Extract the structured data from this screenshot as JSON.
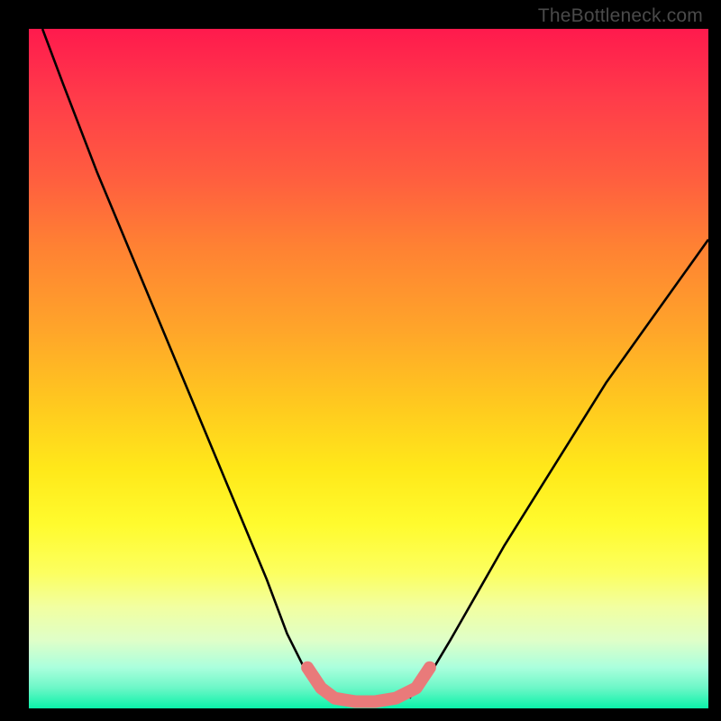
{
  "watermark": "TheBottleneck.com",
  "chart_data": {
    "type": "line",
    "title": "",
    "xlabel": "",
    "ylabel": "",
    "xlim": [
      0,
      100
    ],
    "ylim": [
      0,
      100
    ],
    "grid": false,
    "series": [
      {
        "name": "left-curve",
        "x": [
          2,
          5,
          10,
          15,
          20,
          25,
          30,
          35,
          38,
          41,
          44
        ],
        "values": [
          100,
          92,
          79,
          67,
          55,
          43,
          31,
          19,
          11,
          5,
          1.5
        ]
      },
      {
        "name": "right-curve",
        "x": [
          56,
          59,
          62,
          66,
          70,
          75,
          80,
          85,
          90,
          95,
          100
        ],
        "values": [
          1.5,
          5,
          10,
          17,
          24,
          32,
          40,
          48,
          55,
          62,
          69
        ]
      },
      {
        "name": "bottom-highlight",
        "color": "#e97a7a",
        "x": [
          41,
          43,
          45,
          48,
          51,
          54,
          57,
          59
        ],
        "values": [
          6,
          3,
          1.5,
          1,
          1,
          1.5,
          3,
          6
        ]
      }
    ]
  }
}
